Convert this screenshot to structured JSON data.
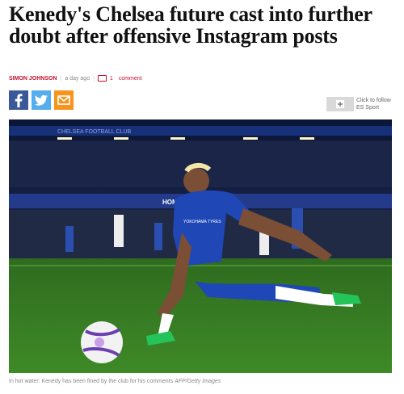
{
  "article": {
    "headline": "Kenedy's Chelsea future cast into further doubt after offensive Instagram posts",
    "author": "SIMON JOHNSON",
    "time": "a day ago",
    "comment_count": "1",
    "comment_label": "comment"
  },
  "share": {
    "buttons": [
      {
        "name": "facebook",
        "icon": "facebook-icon",
        "color": "#3b5998"
      },
      {
        "name": "twitter",
        "icon": "twitter-icon",
        "color": "#55acee"
      },
      {
        "name": "email",
        "icon": "email-icon",
        "color": "#f7941d"
      }
    ]
  },
  "follow": {
    "line1": "Click to follow",
    "line2": "ES Sport"
  },
  "photo": {
    "shirt_sponsor": "YOKOHAMA TYRES",
    "stand_banner": "CHELSEA FOOTBALL CLUB",
    "board_text": "HOME"
  },
  "caption": {
    "text": "In hot water: Kenedy has been fined by the club for his comments",
    "credit": "AFP/Getty Images"
  }
}
